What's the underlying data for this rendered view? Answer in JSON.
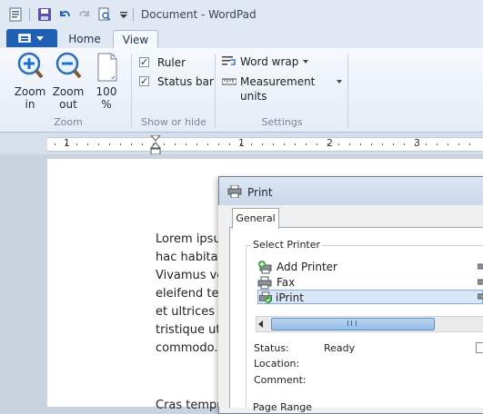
{
  "window": {
    "title": "Document - WordPad"
  },
  "qat": {
    "icons": [
      "wordpad-app-icon",
      "save-icon",
      "undo-icon",
      "redo-icon",
      "print-preview-icon",
      "customize-qat-icon"
    ]
  },
  "ribbon": {
    "tabs": [
      {
        "label": "Home"
      },
      {
        "label": "View"
      }
    ],
    "active_tab": "View",
    "zoom_group": {
      "label": "Zoom",
      "zoom_in": "Zoom\nin",
      "zoom_in_l1": "Zoom",
      "zoom_in_l2": "in",
      "zoom_out_l1": "Zoom",
      "zoom_out_l2": "out",
      "hundred_l1": "100",
      "hundred_l2": "%"
    },
    "show_hide_group": {
      "label": "Show or hide",
      "ruler": {
        "label": "Ruler",
        "checked": true
      },
      "status_bar": {
        "label": "Status bar",
        "checked": true
      }
    },
    "settings_group": {
      "label": "Settings",
      "word_wrap": "Word wrap",
      "measurement_units": "Measurement units"
    }
  },
  "ruler": {
    "numbers": [
      "1",
      "1",
      "2",
      "3"
    ]
  },
  "document": {
    "lines": [
      "Lorem ipsu",
      "hac habitas",
      "Vivamus ve",
      "eleifend te",
      "et ultrices p",
      "tristique ut",
      "commodo.",
      "Cras tempu"
    ]
  },
  "print_dialog": {
    "title": "Print",
    "tab": "General",
    "select_printer_label": "Select Printer",
    "printers": [
      {
        "name": "Add Printer",
        "icon": "add-printer-icon",
        "selected": false
      },
      {
        "name": "Fax",
        "icon": "fax-printer-icon",
        "selected": false
      },
      {
        "name": "iPrint",
        "icon": "iprint-printer-icon",
        "selected": true
      }
    ],
    "status_label": "Status:",
    "status_value": "Ready",
    "location_label": "Location:",
    "comment_label": "Comment:",
    "page_range_label": "Page Range"
  }
}
